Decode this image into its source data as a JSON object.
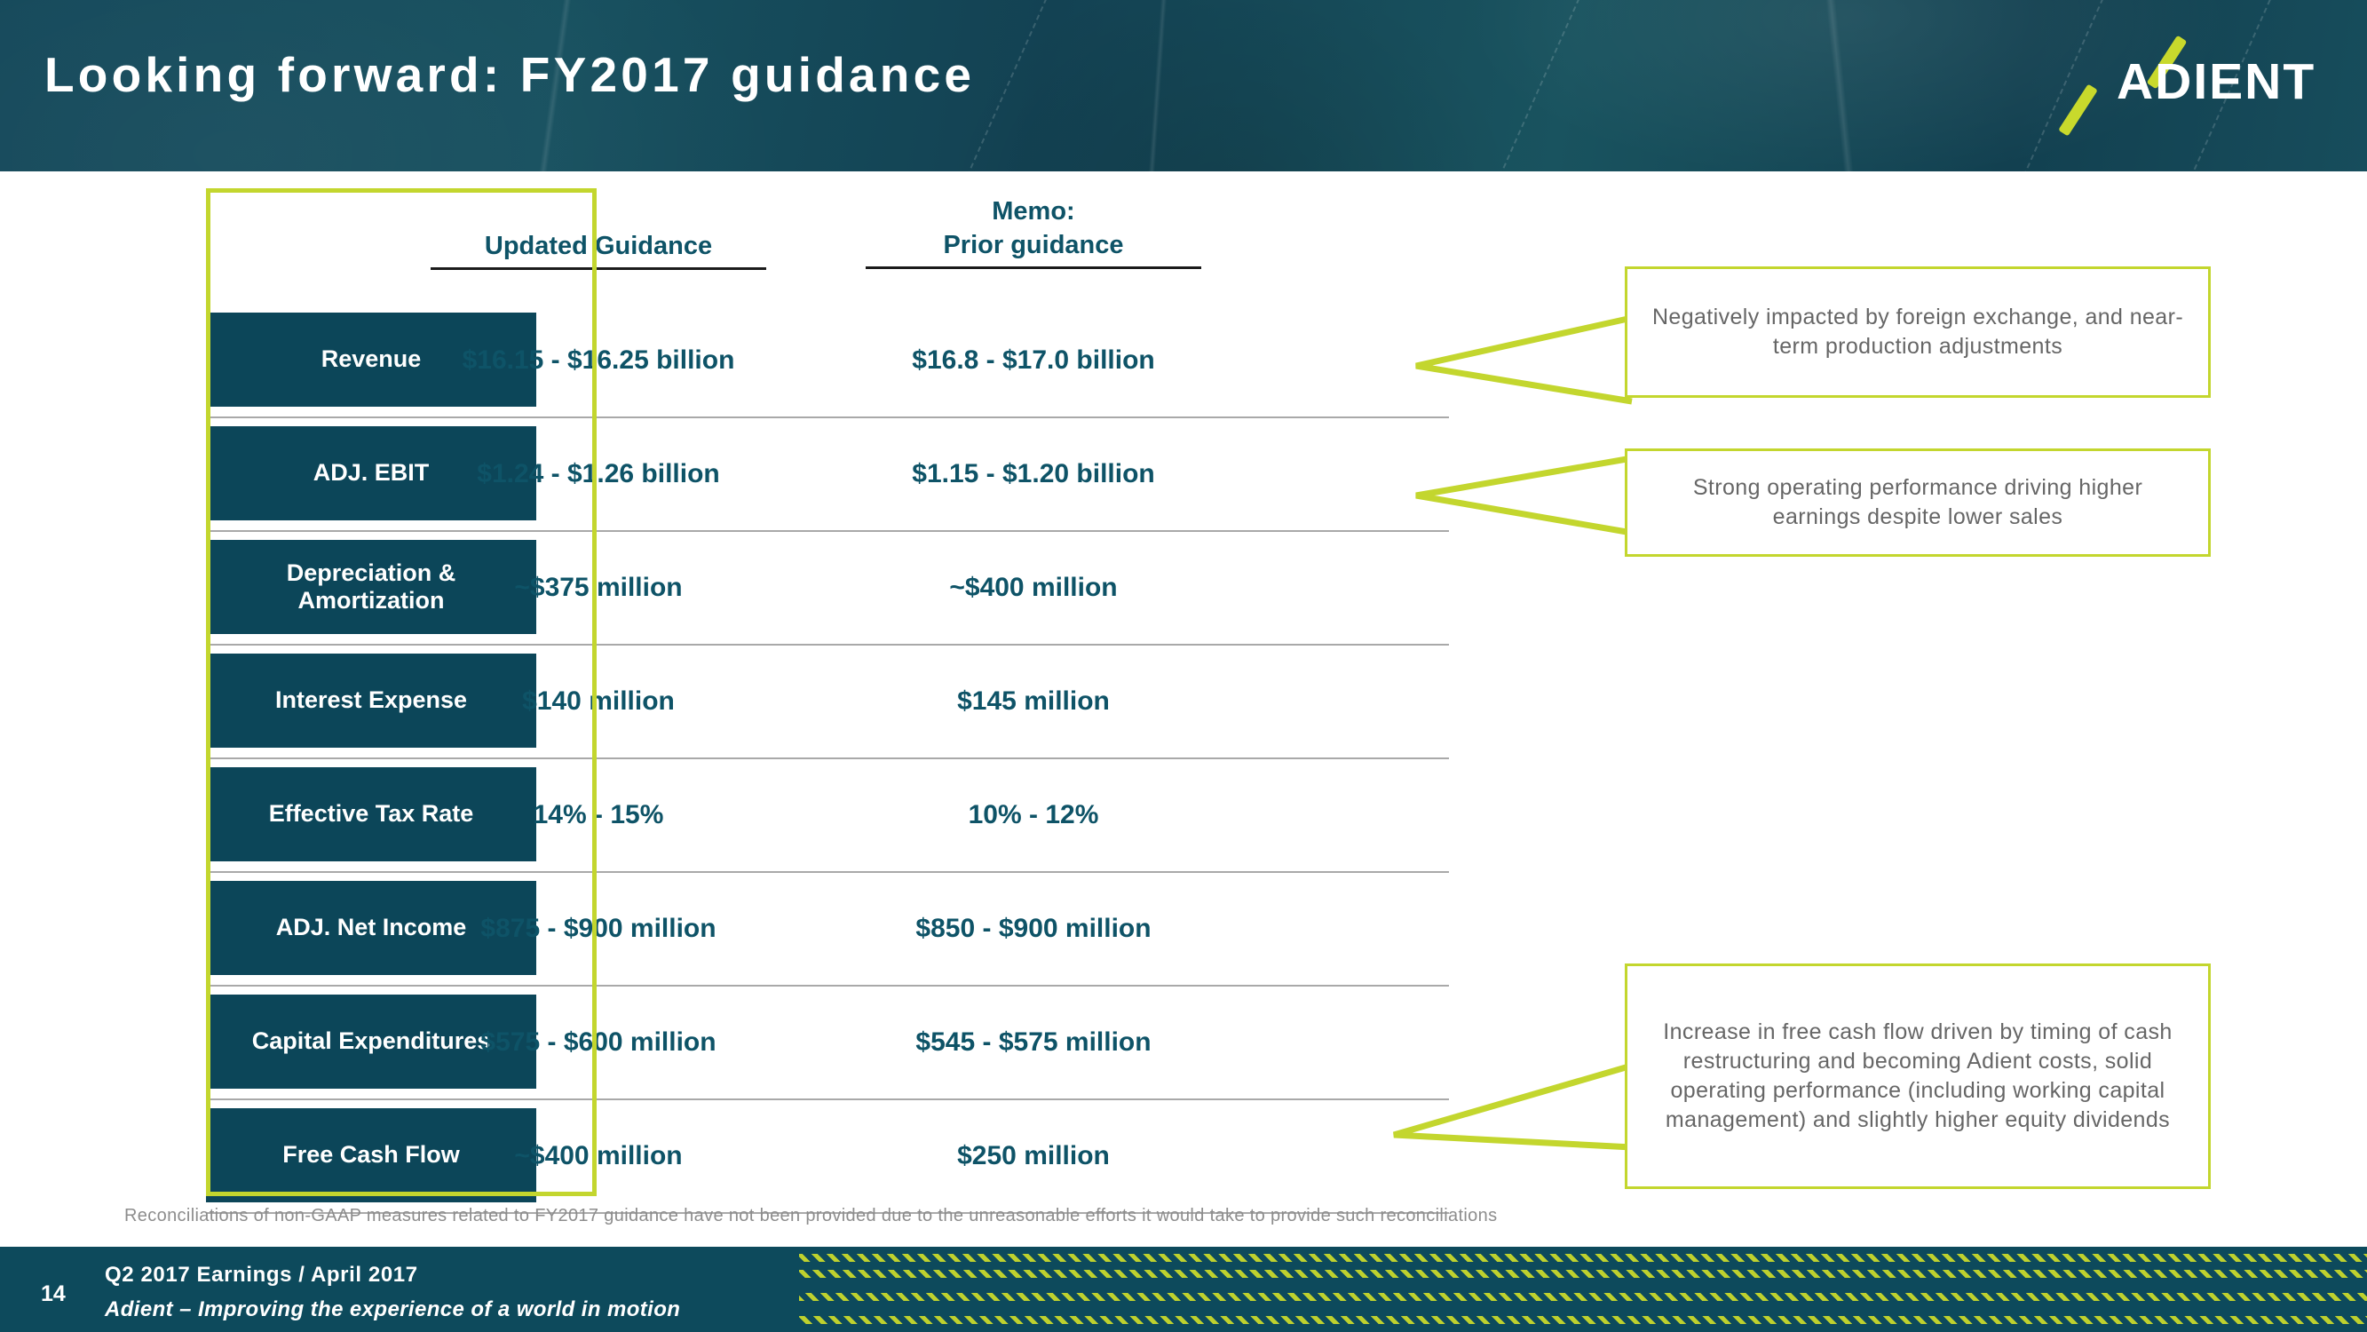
{
  "slide": {
    "title": "Looking forward: FY2017 guidance",
    "logo": {
      "wordmark": "ADIENT"
    },
    "colors": {
      "dark_teal": "#0c4659",
      "header_teal": "#15495b",
      "accent_green": "#c3d62e",
      "value_text": "#0e5367",
      "callout_text": "#666666"
    }
  },
  "table": {
    "columns": [
      {
        "id": "updated",
        "line1": "",
        "line2": "Updated Guidance",
        "highlighted": true
      },
      {
        "id": "prior",
        "line1": "Memo:",
        "line2": "Prior guidance",
        "highlighted": false
      }
    ],
    "rows": [
      {
        "label": "Revenue",
        "updated": "$16.15 - $16.25 billion",
        "prior": "$16.8 - $17.0 billion"
      },
      {
        "label": "ADJ. EBIT",
        "updated": "$1.24 - $1.26 billion",
        "prior": "$1.15 - $1.20 billion"
      },
      {
        "label": "Depreciation & Amortization",
        "updated": "~$375 million",
        "prior": "~$400 million"
      },
      {
        "label": "Interest Expense",
        "updated": "$140 million",
        "prior": "$145 million"
      },
      {
        "label": "Effective Tax Rate",
        "updated": "14% - 15%",
        "prior": "10% - 12%"
      },
      {
        "label": "ADJ. Net Income",
        "updated": "$875 - $900 million",
        "prior": "$850 - $900 million"
      },
      {
        "label": "Capital Expenditures",
        "updated": "$575 - $600 million",
        "prior": "$545 - $575 million"
      },
      {
        "label": "Free Cash Flow",
        "updated": "~$400 million",
        "prior": "$250 million"
      }
    ]
  },
  "callouts": [
    {
      "id": "revenue-note",
      "text": "Negatively impacted by foreign exchange, and near-term production adjustments"
    },
    {
      "id": "ebit-note",
      "text": "Strong operating performance driving higher earnings despite lower sales"
    },
    {
      "id": "fcf-note",
      "text": "Increase in free cash flow driven by timing of cash restructuring and becoming Adient costs, solid operating performance (including working capital management) and slightly higher equity dividends"
    }
  ],
  "footnote": "Reconciliations of non-GAAP measures related to FY2017 guidance have not been provided due to the unreasonable efforts it would take to provide such reconciliations",
  "footer": {
    "page_number": "14",
    "line1": "Q2 2017 Earnings / April 2017",
    "line2": "Adient – Improving the experience of a world in motion"
  }
}
